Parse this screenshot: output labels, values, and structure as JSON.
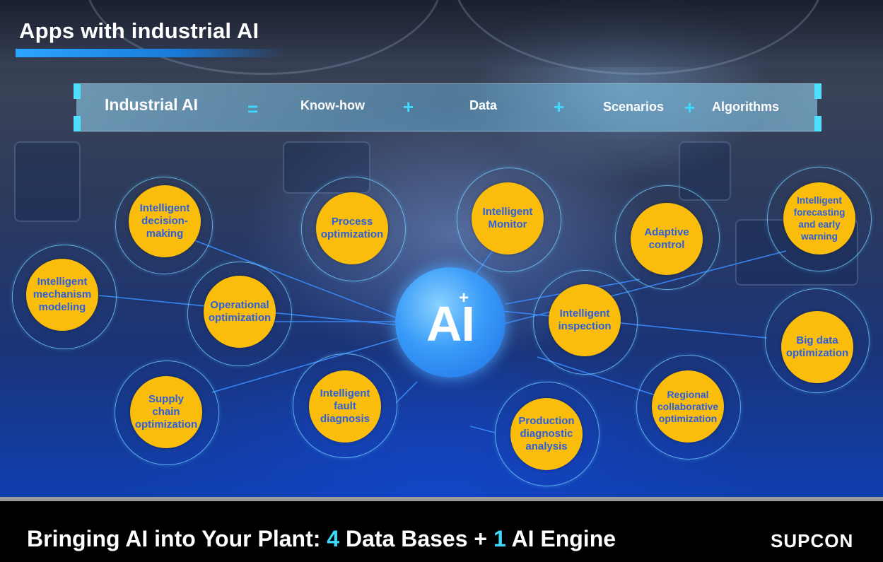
{
  "slide": {
    "title": "Apps with industrial AI"
  },
  "formula": {
    "lhs": "Industrial AI",
    "eq": "=",
    "plus": "+",
    "terms": [
      "Know-how",
      "Data",
      "Scenarios",
      "Algorithms"
    ]
  },
  "center": {
    "label": "AI",
    "plus_mark": "+"
  },
  "nodes": [
    {
      "label": "Intelligent decision-making"
    },
    {
      "label": "Process optimization"
    },
    {
      "label": "Intelligent Monitor"
    },
    {
      "label": "Adaptive control"
    },
    {
      "label": "Intelligent forecasting and early warning"
    },
    {
      "label": "Intelligent mechanism modeling"
    },
    {
      "label": "Operational optimization"
    },
    {
      "label": "Intelligent inspection"
    },
    {
      "label": "Big data optimization"
    },
    {
      "label": "Supply chain optimization"
    },
    {
      "label": "Intelligent fault diagnosis"
    },
    {
      "label": "Production diagnostic analysis"
    },
    {
      "label": "Regional collaborative optimization"
    }
  ],
  "footer": {
    "tagline_parts": [
      "Bringing AI into Your Plant: ",
      "4",
      " Data Bases + ",
      "1",
      " AI Engine"
    ],
    "brand": "SUPCON"
  },
  "colors": {
    "node_fill": "#fbbd0b",
    "node_text": "#2b5fe0",
    "accent_cyan": "#3fd8ff",
    "title_bar": "#2aa6ff"
  }
}
